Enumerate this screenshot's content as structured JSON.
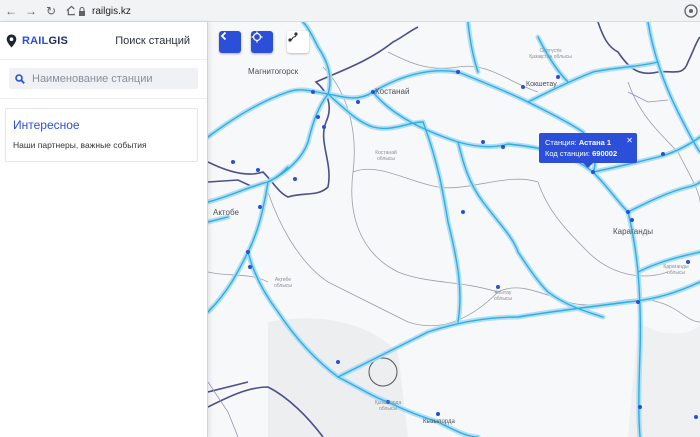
{
  "browser": {
    "url": "railgis.kz"
  },
  "sidebar": {
    "logo_text_accent": "RAIL",
    "logo_text_rest": "GIS",
    "title": "Поиск станций",
    "search_placeholder": "Наименование станции",
    "card": {
      "title": "Интересное",
      "text": "Наши партнеры, важные события"
    }
  },
  "map": {
    "cities": [
      "Магнитогорск",
      "Костанай",
      "Кокшетау",
      "Актобе",
      "Караганды",
      "Кызылорда"
    ],
    "popup": {
      "station_label": "Станция:",
      "station_value": "Астана 1",
      "code_label": "Код станции:",
      "code_value": "690002"
    },
    "oblasts": [
      "Костанай облысы",
      "Ақтөбе облысы",
      "Ұлытау облысы",
      "Қарағанды облысы",
      "Қызылорда облысы",
      "Солтүстік Қазақстан облысы"
    ],
    "colors": {
      "accent": "#2b4fd8",
      "rail_glow": "#a9dcf3",
      "rail_line": "#2eaee6",
      "border": "#4b4f8c"
    }
  }
}
